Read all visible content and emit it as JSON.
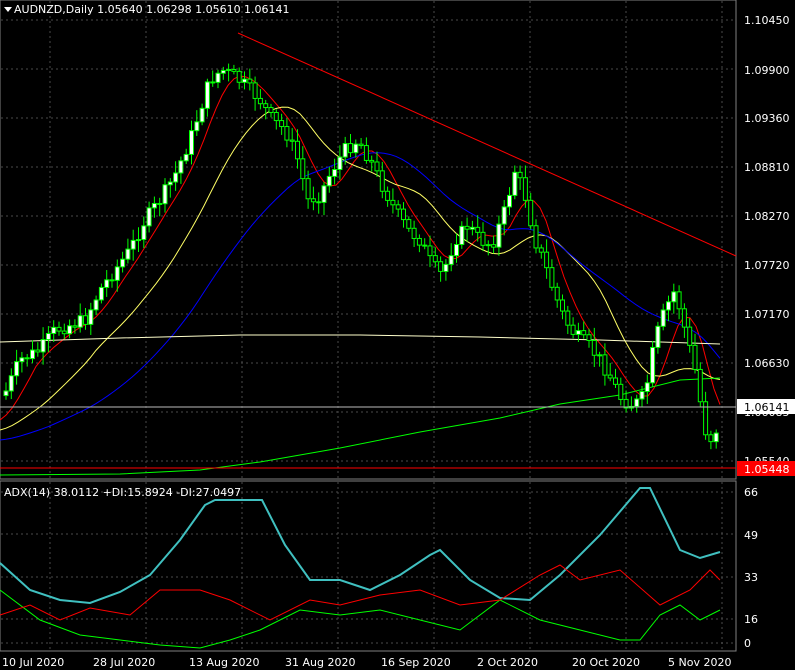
{
  "header": {
    "symbol_line": "AUDNZD,Daily  1.05640 1.06298 1.05610 1.06141"
  },
  "price_axis": {
    "ticks": [
      "1.10450",
      "1.09900",
      "1.09360",
      "1.08810",
      "1.08270",
      "1.07720",
      "1.07170",
      "1.06630",
      "1.06085",
      "1.05540"
    ],
    "current_price": "1.06141",
    "line_price": "1.05448",
    "line_price_bg": "#ff0000"
  },
  "indicator": {
    "label": "ADX(14) 38.0112 +DI:15.8924 -DI:27.0497",
    "ticks": [
      "66",
      "49",
      "33",
      "16",
      "0"
    ]
  },
  "time_axis": {
    "labels": [
      "10 Jul 2020",
      "28 Jul 2020",
      "13 Aug 2020",
      "31 Aug 2020",
      "16 Sep 2020",
      "2 Oct 2020",
      "20 Oct 2020",
      "5 Nov 2020"
    ]
  },
  "colors": {
    "background": "#000000",
    "grid": "#4a4a4a",
    "bull_candle": "#ffffff",
    "bear_candle": "#000000",
    "wick": "#00ff00",
    "ma_fast": "#ff0000",
    "ma_mid": "#ffff66",
    "ma_slow": "#0000ff",
    "ma_200": "#00ff00",
    "ma_white": "#ffffcc",
    "adx": "#40c0c0",
    "plus_di": "#00ff00",
    "minus_di": "#ff0000",
    "trendline": "#ff0000"
  }
}
